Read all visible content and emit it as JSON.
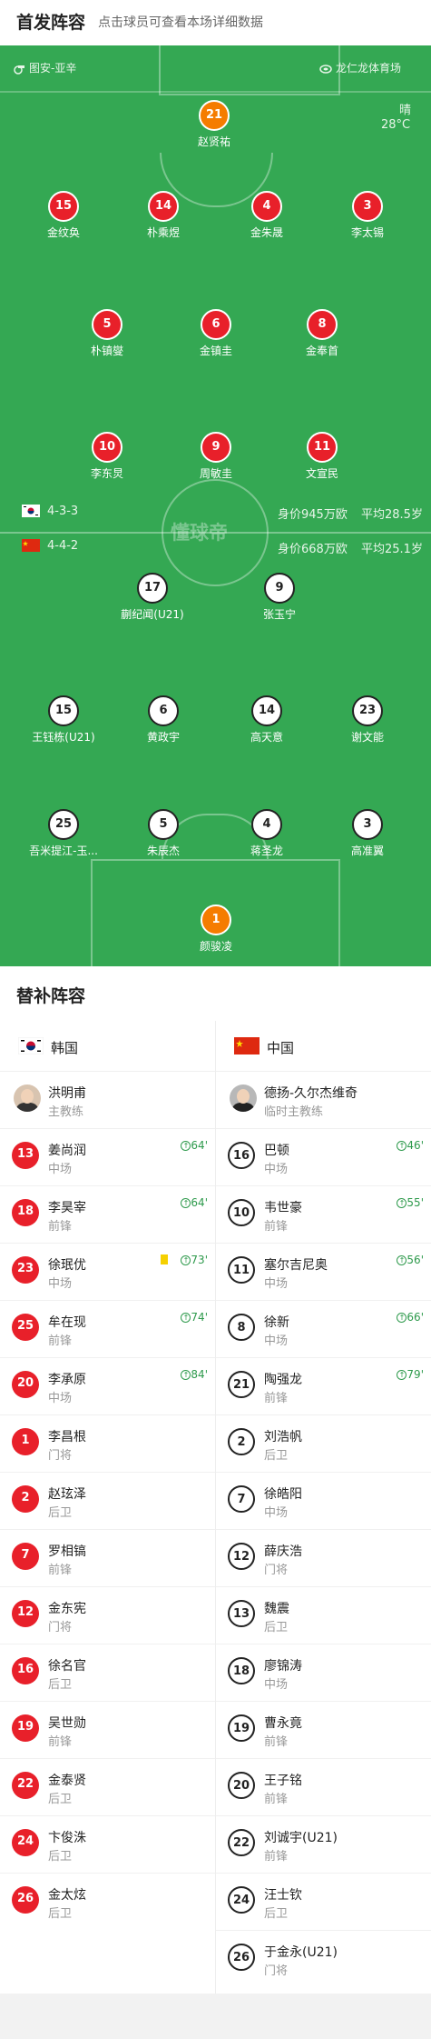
{
  "header": {
    "title": "首发阵容",
    "subtitle": "点击球员可查看本场详细数据"
  },
  "match": {
    "league": "图安-亚辛",
    "venue": "龙仁龙体育场",
    "weather": "晴",
    "temperature": "28°C"
  },
  "home_team": {
    "formation": "4-3-3",
    "value_label": "身价945万欧",
    "age_label": "平均28.5岁",
    "flag_color": "#c60c30"
  },
  "away_team": {
    "formation": "4-4-2",
    "value_label": "身价668万欧",
    "age_label": "平均25.1岁",
    "flag_color": "#de2910"
  },
  "watermark": "懂球帝",
  "home_lineup": [
    {
      "number": "21",
      "name": "赵贤祐",
      "captain": true,
      "role": "gk"
    },
    {
      "number": "15",
      "name": "金纹奂",
      "sub_min": "74'"
    },
    {
      "number": "14",
      "name": "朴乘煜"
    },
    {
      "number": "4",
      "name": "金朱晟",
      "goal": true
    },
    {
      "number": "3",
      "name": "李太锡"
    },
    {
      "number": "5",
      "name": "朴镇燮"
    },
    {
      "number": "6",
      "name": "金镇圭",
      "sub_min": "84'"
    },
    {
      "number": "8",
      "name": "金奉首",
      "sub_min": "73'"
    },
    {
      "number": "10",
      "name": "李东炅",
      "goal": true
    },
    {
      "number": "9",
      "name": "周敏圭",
      "sub_min": "64'",
      "goal": true
    },
    {
      "number": "11",
      "name": "文宣民",
      "sub_min": "64'"
    }
  ],
  "away_lineup": [
    {
      "number": "17",
      "name": "蒯纪闻(U21)",
      "sub_min": "56'"
    },
    {
      "number": "9",
      "name": "张玉宁",
      "captain": true
    },
    {
      "number": "15",
      "name": "王钰栋(U21)",
      "sub_min": "79'"
    },
    {
      "number": "6",
      "name": "黄政宇",
      "sub_min": "66'"
    },
    {
      "number": "14",
      "name": "高天意",
      "yellow": true
    },
    {
      "number": "23",
      "name": "谢文能",
      "sub_min": "55'"
    },
    {
      "number": "25",
      "name": "吾米提江-玉..."
    },
    {
      "number": "5",
      "name": "朱辰杰"
    },
    {
      "number": "4",
      "name": "蒋圣龙"
    },
    {
      "number": "3",
      "name": "高准翼",
      "sub_min": "46'"
    },
    {
      "number": "1",
      "name": "颜骏凌"
    }
  ],
  "bench": {
    "title": "替补阵容",
    "home": {
      "team_name": "韩国",
      "coach": {
        "name": "洪明甫",
        "role": "主教练"
      },
      "players": [
        {
          "number": "13",
          "name": "姜尚润",
          "pos": "中场",
          "sub_in": "64'"
        },
        {
          "number": "18",
          "name": "李昊宰",
          "pos": "前锋",
          "sub_in": "64'"
        },
        {
          "number": "23",
          "name": "徐珉优",
          "pos": "中场",
          "sub_in": "73'",
          "yellow": true
        },
        {
          "number": "25",
          "name": "牟在现",
          "pos": "前锋",
          "sub_in": "74'"
        },
        {
          "number": "20",
          "name": "李承原",
          "pos": "中场",
          "sub_in": "84'"
        },
        {
          "number": "1",
          "name": "李昌根",
          "pos": "门将"
        },
        {
          "number": "2",
          "name": "赵玹泽",
          "pos": "后卫"
        },
        {
          "number": "7",
          "name": "罗相镐",
          "pos": "前锋"
        },
        {
          "number": "12",
          "name": "金东宪",
          "pos": "门将"
        },
        {
          "number": "16",
          "name": "徐名官",
          "pos": "后卫"
        },
        {
          "number": "19",
          "name": "吴世勋",
          "pos": "前锋"
        },
        {
          "number": "22",
          "name": "金泰贤",
          "pos": "后卫"
        },
        {
          "number": "24",
          "name": "卞俊洙",
          "pos": "后卫"
        },
        {
          "number": "26",
          "name": "金太炫",
          "pos": "后卫"
        }
      ]
    },
    "away": {
      "team_name": "中国",
      "coach": {
        "name": "德扬-久尔杰维奇",
        "role": "临时主教练"
      },
      "players": [
        {
          "number": "16",
          "name": "巴顿",
          "pos": "中场",
          "sub_in": "46'"
        },
        {
          "number": "10",
          "name": "韦世豪",
          "pos": "前锋",
          "sub_in": "55'"
        },
        {
          "number": "11",
          "name": "塞尔吉尼奥",
          "pos": "中场",
          "sub_in": "56'"
        },
        {
          "number": "8",
          "name": "徐新",
          "pos": "中场",
          "sub_in": "66'"
        },
        {
          "number": "21",
          "name": "陶强龙",
          "pos": "前锋",
          "sub_in": "79'"
        },
        {
          "number": "2",
          "name": "刘浩帆",
          "pos": "后卫"
        },
        {
          "number": "7",
          "name": "徐皓阳",
          "pos": "中场"
        },
        {
          "number": "12",
          "name": "薛庆浩",
          "pos": "门将"
        },
        {
          "number": "13",
          "name": "魏震",
          "pos": "后卫"
        },
        {
          "number": "18",
          "name": "廖锦涛",
          "pos": "中场"
        },
        {
          "number": "19",
          "name": "曹永竟",
          "pos": "前锋"
        },
        {
          "number": "20",
          "name": "王子铭",
          "pos": "前锋"
        },
        {
          "number": "22",
          "name": "刘诚宇(U21)",
          "pos": "前锋"
        },
        {
          "number": "24",
          "name": "汪士钦",
          "pos": "后卫"
        },
        {
          "number": "26",
          "name": "于金永(U21)",
          "pos": "门将"
        }
      ]
    }
  },
  "icons": {
    "sub_arrow": "↑",
    "captain": "C"
  }
}
